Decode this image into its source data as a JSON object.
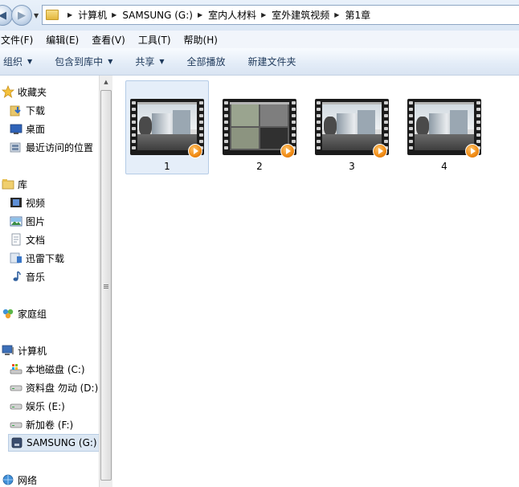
{
  "address": {
    "crumbs": [
      "计算机",
      "SAMSUNG (G:)",
      "室内人材料",
      "室外建筑视频",
      "第1章"
    ]
  },
  "menu": {
    "file": "文件(F)",
    "edit": "编辑(E)",
    "view": "查看(V)",
    "tools": "工具(T)",
    "help": "帮助(H)"
  },
  "toolbar": {
    "organize": "组织",
    "include_library": "包含到库中",
    "share": "共享",
    "play_all": "全部播放",
    "new_folder": "新建文件夹"
  },
  "nav": {
    "favorites": "收藏夹",
    "downloads": "下载",
    "desktop": "桌面",
    "recent": "最近访问的位置",
    "libraries": "库",
    "videos": "视频",
    "pictures": "图片",
    "documents": "文档",
    "thunder": "迅雷下载",
    "music": "音乐",
    "homegroup": "家庭组",
    "computer": "计算机",
    "drive_c": "本地磁盘 (C:)",
    "drive_d": "资料盘 勿动 (D:)",
    "drive_e": "娱乐 (E:)",
    "drive_f": "新加卷 (F:)",
    "drive_g": "SAMSUNG (G:)",
    "network": "网络"
  },
  "files": [
    {
      "name": "1",
      "selected": true
    },
    {
      "name": "2",
      "selected": false
    },
    {
      "name": "3",
      "selected": false
    },
    {
      "name": "4",
      "selected": false
    }
  ],
  "colors": {
    "selection": "#e5eef9",
    "toolbar_text": "#1e395b",
    "play_badge": "#f08a12"
  }
}
